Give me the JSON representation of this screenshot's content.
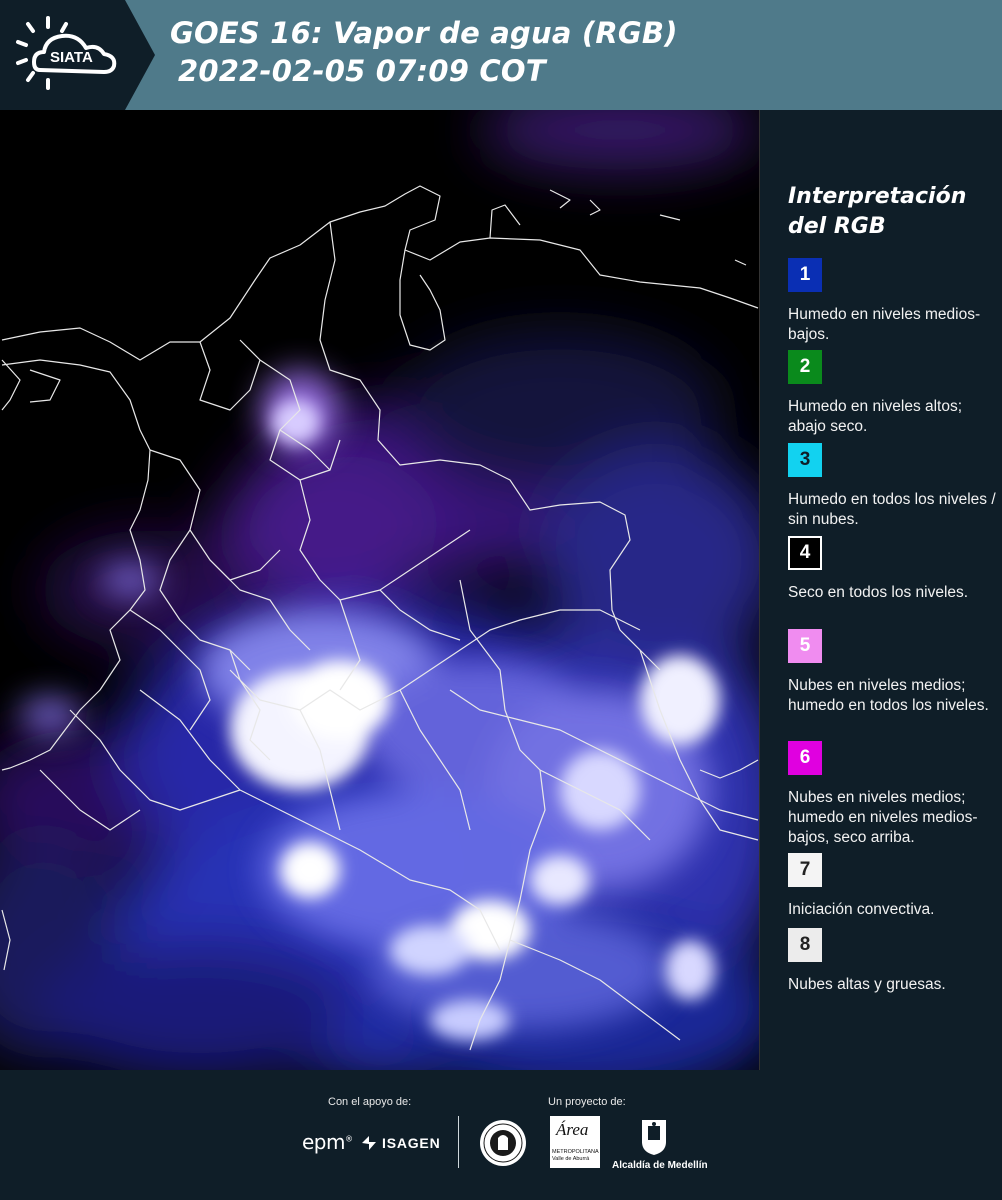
{
  "header": {
    "logo_text": "SIATA",
    "title_line1": "GOES 16: Vapor de agua (RGB)",
    "title_line2": "2022-02-05 07:09 COT",
    "background_color": "#4f7a8a",
    "logo_background_color": "#0f1e28"
  },
  "map": {
    "image_type": "satellite water vapor RGB composite",
    "overlay": "administrative borders (white)"
  },
  "legend": {
    "title_line1": "Interpretación",
    "title_line2": "del RGB",
    "items": [
      {
        "number": "1",
        "color": "#0a2fb4",
        "text_color": "#ffffff",
        "label": "Humedo en niveles medios-bajos."
      },
      {
        "number": "2",
        "color": "#0a8a1c",
        "text_color": "#ffffff",
        "label": "Humedo en niveles altos; abajo seco."
      },
      {
        "number": "3",
        "color": "#12d2f0",
        "text_color": "#0f1e28",
        "label": "Humedo en todos los niveles / sin nubes."
      },
      {
        "number": "4",
        "color": "#000000",
        "text_color": "#ffffff",
        "label": "Seco en todos los niveles."
      },
      {
        "number": "5",
        "color": "#f08cf0",
        "text_color": "#ffffff",
        "label": "Nubes en niveles medios; humedo en todos los niveles."
      },
      {
        "number": "6",
        "color": "#e000e0",
        "text_color": "#ffffff",
        "label": "Nubes en niveles medios; humedo en niveles medios-bajos, seco arriba."
      },
      {
        "number": "7",
        "color": "#f4f4f4",
        "text_color": "#222222",
        "label": "Iniciación convectiva."
      },
      {
        "number": "8",
        "color": "#ececec",
        "text_color": "#222222",
        "label": "Nubes altas y gruesas."
      }
    ]
  },
  "footer": {
    "support_label": "Con el apoyo de:",
    "project_label": "Un proyecto de:",
    "sponsor_epm": "epm",
    "sponsor_isagen": "ISAGEN",
    "area_logo_word": "Área",
    "area_logo_sub": "METROPOLITANA Valle de Aburrá",
    "medellin_label": "Alcaldía de Medellín"
  }
}
